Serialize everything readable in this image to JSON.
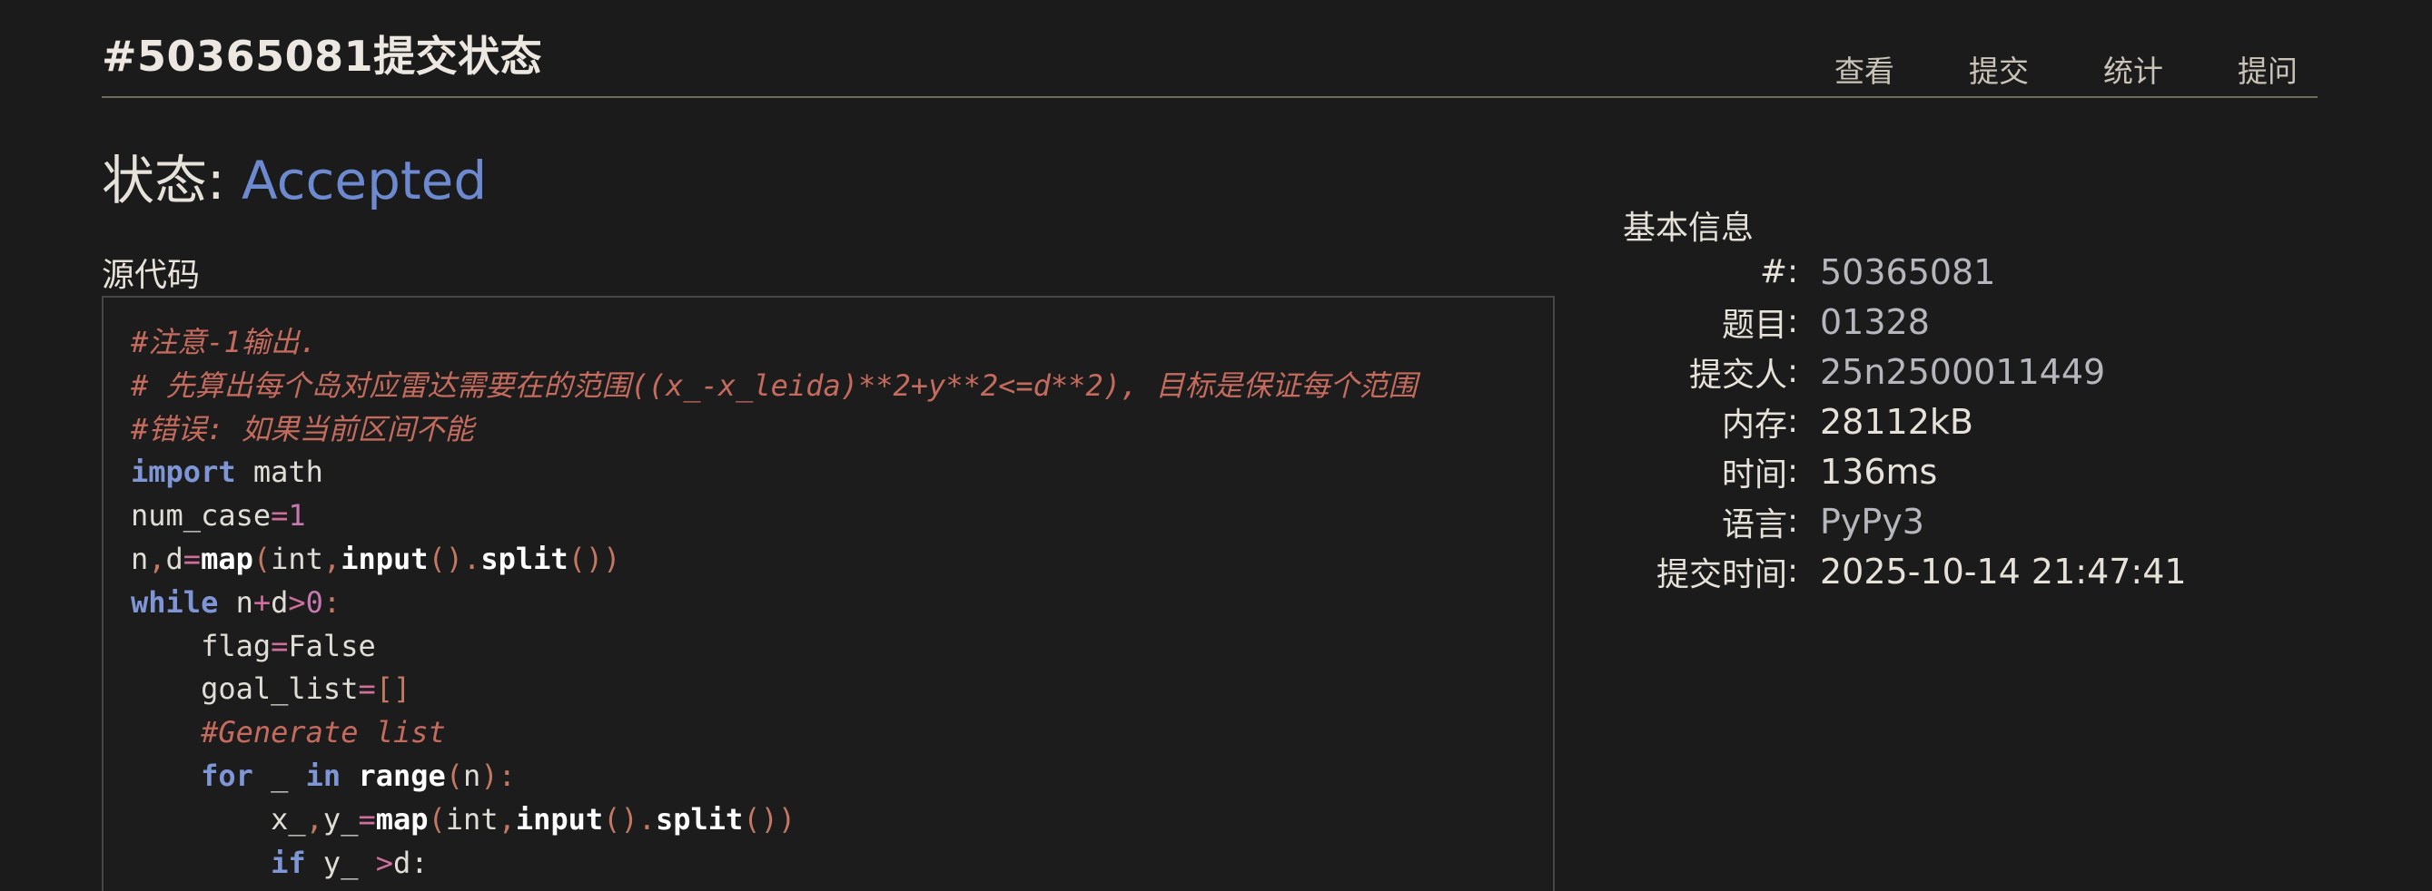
{
  "page": {
    "title": "#50365081提交状态"
  },
  "nav": {
    "items": [
      {
        "label": "查看"
      },
      {
        "label": "提交"
      },
      {
        "label": "统计"
      },
      {
        "label": "提问"
      }
    ]
  },
  "status": {
    "label": "状态: ",
    "value": "Accepted",
    "value_color": "#6d8ad0"
  },
  "source": {
    "label": "源代码"
  },
  "info": {
    "title": "基本信息",
    "rows": [
      {
        "key": "#",
        "value": "50365081"
      },
      {
        "key": "题目",
        "value": "01328"
      },
      {
        "key": "提交人",
        "value": "25n2500011449"
      },
      {
        "key": "内存",
        "value": "28112kB"
      },
      {
        "key": "时间",
        "value": "136ms"
      },
      {
        "key": "语言",
        "value": "PyPy3"
      },
      {
        "key": "提交时间",
        "value": "2025-10-14 21:47:41"
      }
    ]
  },
  "code_tokens": {
    "l1": [
      "#注意-1输出."
    ],
    "l2": [
      "# 先算出每个岛对应雷达需要在的范围((x_-x_leida)**2+y**2<=d**2), 目标是保证每个范围"
    ],
    "l3": [
      "#错误: 如果当前区间不能"
    ],
    "l4": [
      "import",
      " math"
    ],
    "l5": [
      "num_case",
      "=",
      "1"
    ],
    "l6": [
      "n",
      ",",
      "d",
      "=",
      "map",
      "(",
      "int",
      ",",
      "input",
      "().",
      "split",
      "())"
    ],
    "l7": [
      "while",
      " n",
      "+",
      "d",
      ">",
      "0",
      ":"
    ],
    "l8": [
      "    flag",
      "=",
      "False"
    ],
    "l9": [
      "    goal_list",
      "=",
      "[]"
    ],
    "l10": [
      "    #Generate list"
    ],
    "l11": [
      "    ",
      "for",
      " _ ",
      "in",
      " ",
      "range",
      "(",
      "n",
      "):"
    ],
    "l12": [
      "        x_",
      ",",
      "y_",
      "=",
      "map",
      "(",
      "int",
      ",",
      "input",
      "().",
      "split",
      "())"
    ],
    "l13": [
      "        ",
      "if",
      " y_ ",
      ">",
      "d:"
    ]
  },
  "colors": {
    "background": "#1b1b1b",
    "comment": "#c46b5e",
    "keyword": "#7f96d6",
    "builtin": "#ffffff",
    "operator": "#d06f9c",
    "number": "#c679b0",
    "punctuation": "#c37862"
  }
}
